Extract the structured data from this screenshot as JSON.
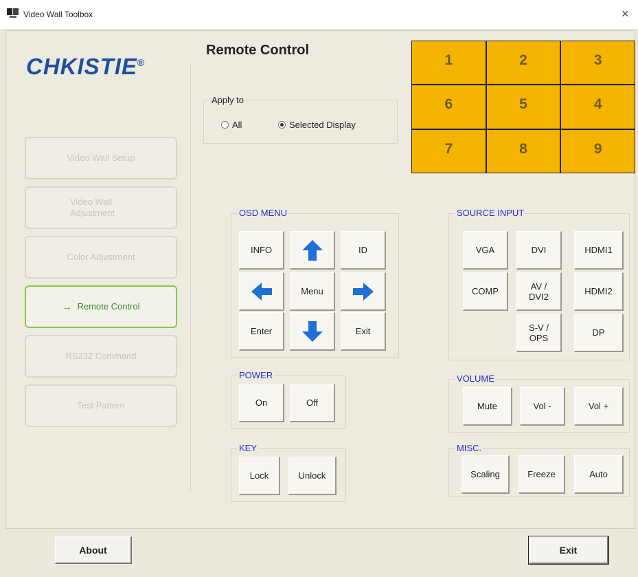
{
  "window": {
    "title": "Video Wall Toolbox",
    "close_glyph": "×"
  },
  "logo": {
    "text": "CHKISTIE",
    "mark": "®"
  },
  "sidebar": {
    "items": [
      {
        "label": "Video Wall Setup",
        "active": false
      },
      {
        "label": "Video Wall Adjustment",
        "active": false
      },
      {
        "label": "Color Adjustment",
        "active": false
      },
      {
        "label": "Remote Control",
        "active": true
      },
      {
        "label": "RS232 Command",
        "active": false
      },
      {
        "label": "Test Pattern",
        "active": false
      }
    ]
  },
  "page": {
    "title": "Remote Control"
  },
  "apply_to": {
    "label": "Apply to",
    "options": [
      "All",
      "Selected Display"
    ],
    "selected": "Selected Display"
  },
  "display_grid": {
    "cells": [
      "1",
      "2",
      "3",
      "6",
      "5",
      "4",
      "7",
      "8",
      "9"
    ],
    "cell_color": "#f5b400"
  },
  "osd_menu": {
    "label": "OSD MENU",
    "info": "INFO",
    "id": "ID",
    "menu": "Menu",
    "enter": "Enter",
    "exit": "Exit",
    "arrow_color": "#1f6fd6",
    "arrows": [
      "up-arrow-icon",
      "left-arrow-icon",
      "right-arrow-icon",
      "down-arrow-icon"
    ]
  },
  "source_input": {
    "label": "SOURCE INPUT",
    "vga": "VGA",
    "dvi": "DVI",
    "hdmi1": "HDMI1",
    "comp": "COMP",
    "av_dvi2": "AV / DVI2",
    "hdmi2": "HDMI2",
    "sv_ops": "S-V / OPS",
    "dp": "DP"
  },
  "power": {
    "label": "POWER",
    "on": "On",
    "off": "Off"
  },
  "volume": {
    "label": "VOLUME",
    "mute": "Mute",
    "vol_down": "Vol -",
    "vol_up": "Vol +"
  },
  "key": {
    "label": "KEY",
    "lock": "Lock",
    "unlock": "Unlock"
  },
  "misc": {
    "label": "MISC.",
    "scaling": "Scaling",
    "freeze": "Freeze",
    "auto": "Auto"
  },
  "footer": {
    "about": "About",
    "exit": "Exit"
  }
}
